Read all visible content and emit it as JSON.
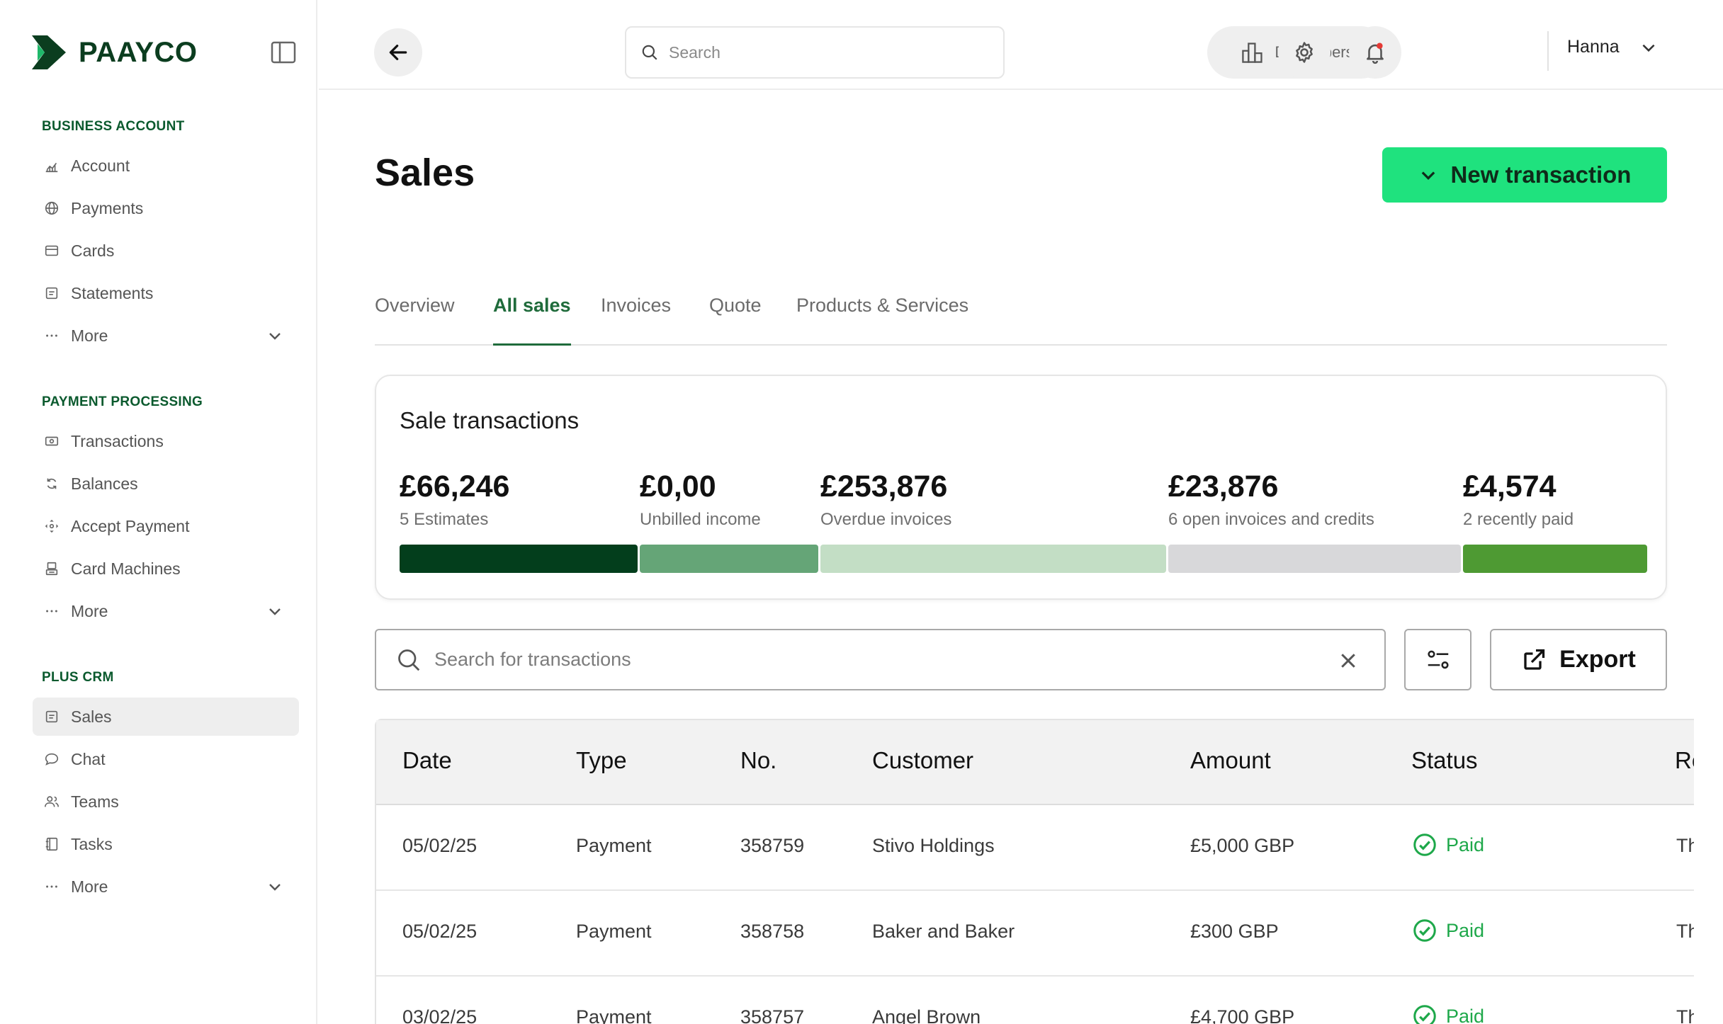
{
  "brand": {
    "name": "PAAYCO"
  },
  "sidebar": {
    "sections": [
      {
        "title": "BUSINESS ACCOUNT",
        "items": [
          {
            "label": "Account",
            "icon": "chart-icon"
          },
          {
            "label": "Payments",
            "icon": "globe-icon"
          },
          {
            "label": "Cards",
            "icon": "card-icon"
          },
          {
            "label": "Statements",
            "icon": "document-icon"
          },
          {
            "label": "More",
            "icon": "dots-icon"
          }
        ]
      },
      {
        "title": "PAYMENT PROCESSING",
        "items": [
          {
            "label": "Transactions",
            "icon": "cash-icon"
          },
          {
            "label": "Balances",
            "icon": "refresh-icon"
          },
          {
            "label": "Accept Payment",
            "icon": "move-icon"
          },
          {
            "label": "Card Machines",
            "icon": "terminal-icon"
          },
          {
            "label": "More",
            "icon": "dots-icon"
          }
        ]
      },
      {
        "title": "PLUS CRM",
        "items": [
          {
            "label": "Sales",
            "icon": "document-icon",
            "active": true
          },
          {
            "label": "Chat",
            "icon": "chat-icon"
          },
          {
            "label": "Teams",
            "icon": "users-icon"
          },
          {
            "label": "Tasks",
            "icon": "book-icon"
          },
          {
            "label": "More",
            "icon": "dots-icon"
          }
        ]
      }
    ]
  },
  "topbar": {
    "search_placeholder": "Search",
    "developers_label": "Developers",
    "user_name": "Hanna"
  },
  "page": {
    "title": "Sales",
    "new_transaction_label": "New transaction"
  },
  "tabs": [
    {
      "label": "Overview",
      "active": false
    },
    {
      "label": "All sales",
      "active": true
    },
    {
      "label": "Invoices",
      "active": false
    },
    {
      "label": "Quote",
      "active": false
    },
    {
      "label": "Products & Services",
      "active": false
    }
  ],
  "summary": {
    "title": "Sale transactions",
    "metrics": [
      {
        "amount": "£66,246",
        "caption": "5 Estimates",
        "color": "#033e1c"
      },
      {
        "amount": "£0,00",
        "caption": "Unbilled income",
        "color": "#65a577"
      },
      {
        "amount": "£253,876",
        "caption": "Overdue invoices",
        "color": "#c3dec5"
      },
      {
        "amount": "£23,876",
        "caption": "6 open invoices and credits",
        "color": "#d8d8da"
      },
      {
        "amount": "£4,574",
        "caption": "2 recently paid",
        "color": "#4e9a33"
      }
    ]
  },
  "transactions": {
    "search_placeholder": "Search for transactions",
    "export_label": "Export",
    "columns": [
      "Date",
      "Type",
      "No.",
      "Customer",
      "Amount",
      "Status",
      "Re"
    ],
    "rows": [
      {
        "date": "05/02/25",
        "type": "Payment",
        "no": "358759",
        "customer": "Stivo Holdings",
        "amount": "£5,000 GBP",
        "status": "Paid",
        "extra": "Th"
      },
      {
        "date": "05/02/25",
        "type": "Payment",
        "no": "358758",
        "customer": "Baker and Baker",
        "amount": "£300 GBP",
        "status": "Paid",
        "extra": "Th"
      },
      {
        "date": "03/02/25",
        "type": "Payment",
        "no": "358757",
        "customer": "Angel Brown",
        "amount": "£4,700 GBP",
        "status": "Paid",
        "extra": "Th"
      }
    ]
  },
  "colors": {
    "brand_green": "#0b3d1f",
    "accent": "#1fe27e",
    "active_tab": "#1f6b3b",
    "paid": "#1ea84a",
    "notification_dot": "#e53935"
  }
}
